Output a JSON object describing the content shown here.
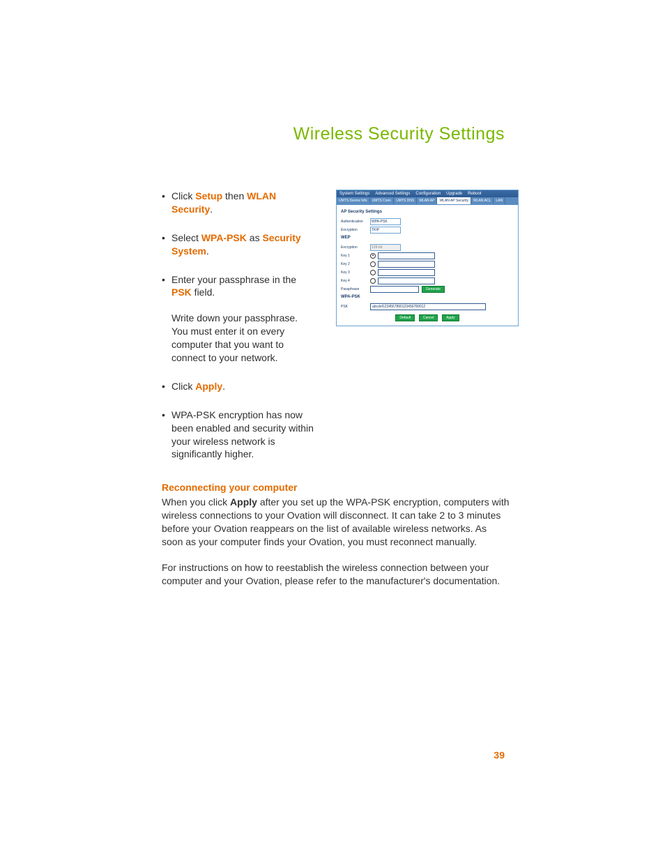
{
  "page_title": "Wireless Security Settings",
  "page_number": "39",
  "bullets": [
    {
      "pre": "Click ",
      "kw1": "Setup",
      "mid": " then ",
      "kw2": "WLAN Security",
      "post": "."
    },
    {
      "pre": "Select ",
      "kw1": "WPA-PSK",
      "mid": " as ",
      "kw2": "Security System",
      "post": "."
    },
    {
      "pre": "Enter your passphrase in the ",
      "kw1": "PSK",
      "mid": " field.",
      "kw2": "",
      "post": ""
    }
  ],
  "note": "Write down your passphrase. You must enter it on every computer that you want to connect to your network.",
  "bullet4": {
    "pre": "Click ",
    "kw": "Apply",
    "post": "."
  },
  "bullet5": "WPA-PSK encryption has now been enabled and security within your wireless network is significantly higher.",
  "reconnect": {
    "heading": "Reconnecting your computer",
    "p1_a": "When you click ",
    "p1_kw": "Apply",
    "p1_b": " after you set up the WPA-PSK encryption, computers with wireless connections to your Ovation will disconnect. It can take 2 to 3 minutes before your Ovation reappears on the list of available wireless networks. As soon as your computer finds your Ovation, you must reconnect manually.",
    "p2": "For instructions on how to reestablish the wireless connection between your computer and your Ovation, please refer to the manufacturer's documentation."
  },
  "shot": {
    "menu": [
      "System Settings",
      "Advanced Settings",
      "Configuration",
      "Upgrade",
      "Reboot"
    ],
    "tabs": [
      "UMTS Device Info",
      "UMTS Conn",
      "UMTS DNS",
      "WLAN AP",
      "WLAN AP Security",
      "WLAN ACL",
      "LAN"
    ],
    "active_tab": 4,
    "section1": "AP Security Settings",
    "auth_lbl": "Authentication",
    "auth_val": "WPA-PSK",
    "enc_lbl": "Encryption",
    "enc_val": "TKIP",
    "wep_title": "WEP",
    "wep_enc_lbl": "Encryption",
    "wep_enc_val": "128-bit",
    "keys": [
      "Key 1",
      "Key 2",
      "Key 3",
      "Key 4"
    ],
    "passphrase_lbl": "Passphrase",
    "generate_btn": "Generate",
    "wpapsk_title": "WPA-PSK",
    "psk_lbl": "PSK",
    "psk_val": "abcdef1234567890123456789012",
    "btns": [
      "Default",
      "Cancel",
      "Apply"
    ]
  }
}
